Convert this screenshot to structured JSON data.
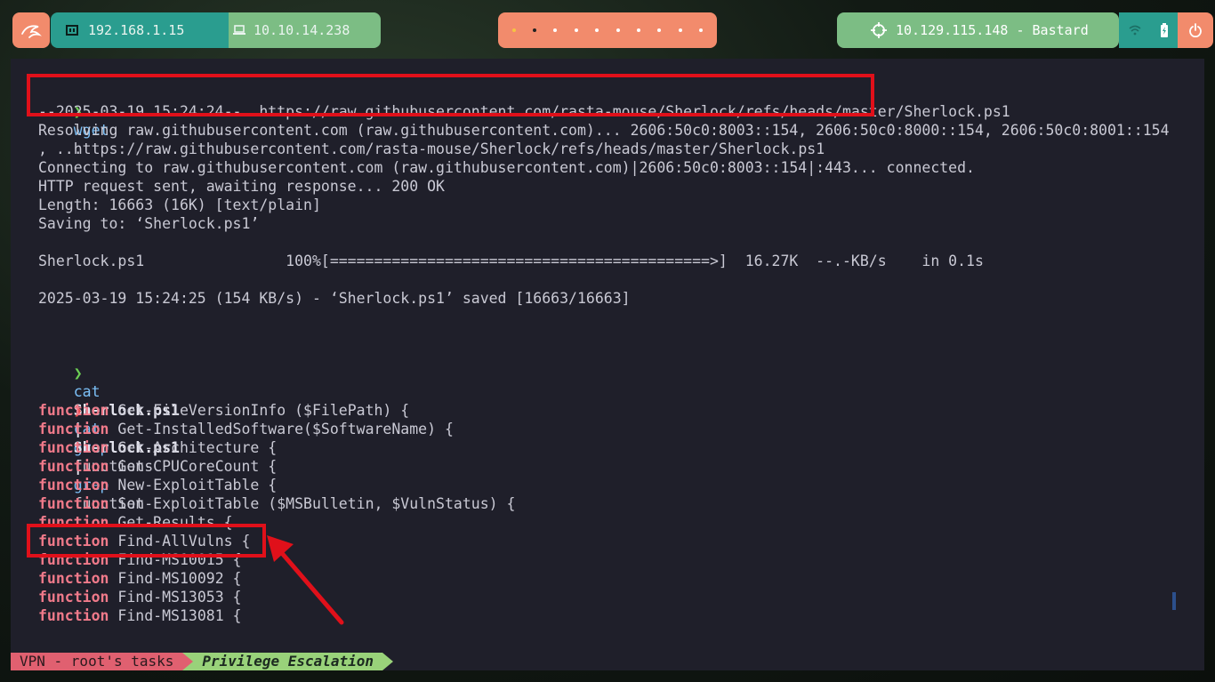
{
  "topbar": {
    "local_ip": "192.168.1.15",
    "vpn_ip": "10.10.14.238",
    "target": "10.129.115.148 - Bastard",
    "workspace_count": 10,
    "active_workspace": 2,
    "icons": [
      "kali-dragon-icon",
      "ethernet-icon",
      "laptop-icon",
      "crosshair-icon",
      "network-icon",
      "battery-icon",
      "power-icon"
    ],
    "colors": {
      "salmon": "#f28b6c",
      "teal": "#2a9d8f",
      "green": "#7cbd84"
    }
  },
  "terminal": {
    "prompt_glyph": "❯",
    "cmd1": {
      "command": "wget",
      "args": "https://raw.githubusercontent.com/rasta-mouse/Sherlock/refs/heads/master/Sherlock.ps1"
    },
    "wget_output": [
      "--2025-03-19 15:24:24--  https://raw.githubusercontent.com/rasta-mouse/Sherlock/refs/heads/master/Sherlock.ps1",
      "Resolving raw.githubusercontent.com (raw.githubusercontent.com)... 2606:50c0:8003::154, 2606:50c0:8000::154, 2606:50c0:8001::154",
      ", ...",
      "Connecting to raw.githubusercontent.com (raw.githubusercontent.com)|2606:50c0:8003::154|:443... connected.",
      "HTTP request sent, awaiting response... 200 OK",
      "Length: 16663 (16K) [text/plain]",
      "Saving to: ‘Sherlock.ps1’",
      "",
      "Sherlock.ps1                100%[===========================================>]  16.27K  --.-KB/s    in 0.1s",
      "",
      "2025-03-19 15:24:25 (154 KB/s) - ‘Sherlock.ps1’ saved [16663/16663]"
    ],
    "cmd2": {
      "cmd": "cat",
      "file": "Sherlock.ps1",
      "pipe": "|",
      "grep": "grep",
      "pattern": "functions"
    },
    "cmd3": {
      "cmd": "cat",
      "file": "Sherlock.ps1",
      "pipe": "|",
      "grep": "grep",
      "pattern": "function"
    },
    "function_keyword": "function",
    "functions": [
      "Get-FileVersionInfo ($FilePath) {",
      "Get-InstalledSoftware($SoftwareName) {",
      "Get-Architecture {",
      "Get-CPUCoreCount {",
      "New-ExploitTable {",
      "Set-ExploitTable ($MSBulletin, $VulnStatus) {",
      "Get-Results {",
      "Find-AllVulns {",
      "Find-MS10015 {",
      "Find-MS10092 {",
      "Find-MS13053 {",
      "Find-MS13081 {"
    ]
  },
  "statusbar": {
    "session": "VPN - root's tasks",
    "task": "Privilege Escalation"
  },
  "annotation_color": "#e0101a"
}
